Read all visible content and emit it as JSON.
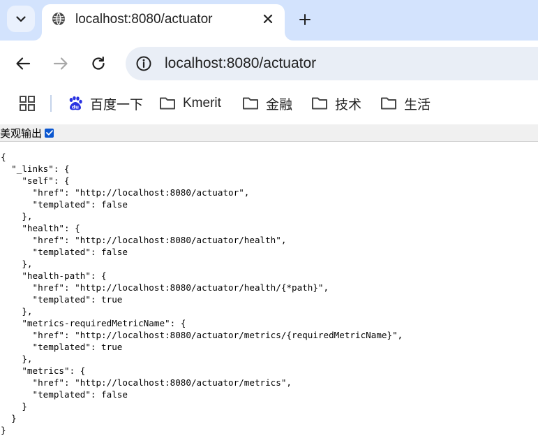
{
  "browser": {
    "tab_title": "localhost:8080/actuator",
    "address_bar_url": "localhost:8080/actuator",
    "accent_color": "#d3e3fd"
  },
  "bookmarks": [
    {
      "label": "百度一下",
      "icon": "baidu-icon"
    },
    {
      "label": "Kmerit",
      "icon": "folder-icon"
    },
    {
      "label": "金融",
      "icon": "folder-icon"
    },
    {
      "label": "技术",
      "icon": "folder-icon"
    },
    {
      "label": "生活",
      "icon": "folder-icon"
    }
  ],
  "page": {
    "pretty_print_label": "美观输出",
    "pretty_print_checked": true,
    "json_lines": [
      "{",
      "  \"_links\": {",
      "    \"self\": {",
      "      \"href\": \"http://localhost:8080/actuator\",",
      "      \"templated\": false",
      "    },",
      "    \"health\": {",
      "      \"href\": \"http://localhost:8080/actuator/health\",",
      "      \"templated\": false",
      "    },",
      "    \"health-path\": {",
      "      \"href\": \"http://localhost:8080/actuator/health/{*path}\",",
      "      \"templated\": true",
      "    },",
      "    \"metrics-requiredMetricName\": {",
      "      \"href\": \"http://localhost:8080/actuator/metrics/{requiredMetricName}\",",
      "      \"templated\": true",
      "    },",
      "    \"metrics\": {",
      "      \"href\": \"http://localhost:8080/actuator/metrics\",",
      "      \"templated\": false",
      "    }",
      "  }",
      "}"
    ]
  }
}
